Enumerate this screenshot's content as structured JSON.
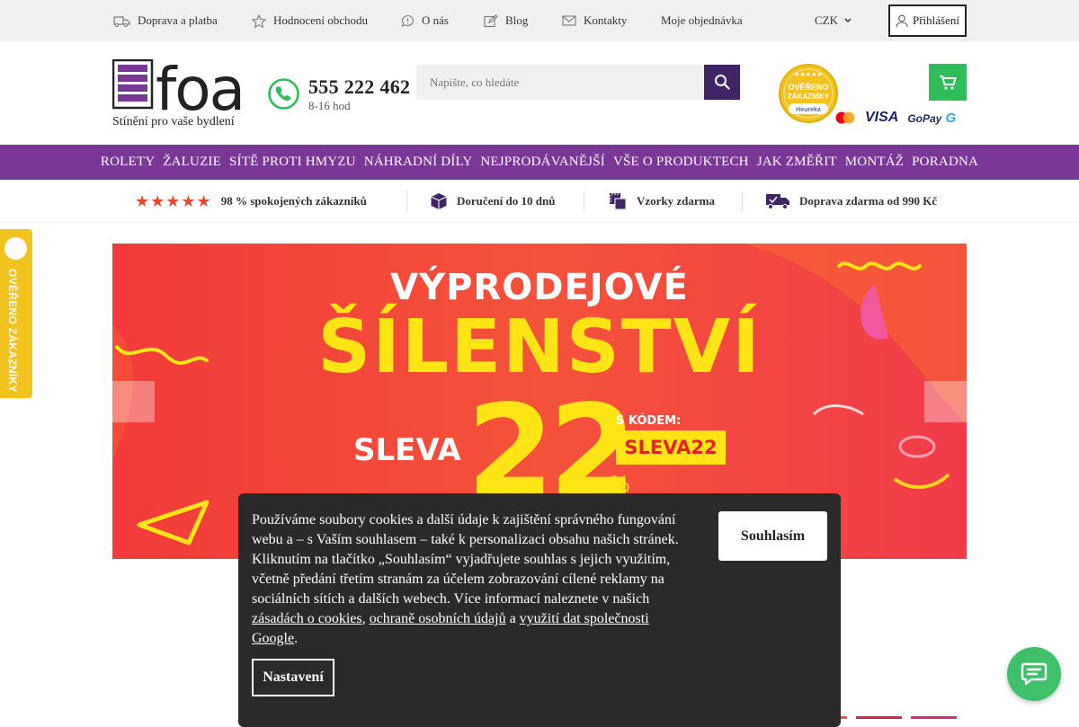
{
  "topbar": {
    "shipping": "Doprava a platba",
    "reviews": "Hodnocení obchodu",
    "about": "O nás",
    "blog": "Blog",
    "contacts": "Kontakty",
    "my_order": "Moje objednávka",
    "currency": "CZK",
    "login": "Přihlášení"
  },
  "header": {
    "logo_text": "foa",
    "tagline": "Stínění pro vaše bydlení",
    "phone": "555 222 462",
    "hours": "8-16 hod",
    "search_placeholder": "Napište, co hledáte",
    "heureka_line1": "OVĚŘENO",
    "heureka_line2": "ZÁKAZNÍKY",
    "heureka_brand": "Heureka",
    "payments": {
      "visa": "VISA",
      "gopay": "GoPay"
    }
  },
  "nav": {
    "items": [
      "ROLETY",
      "ŽALUZIE",
      "SÍTĚ PROTI HMYZU",
      "NÁHRADNÍ DÍLY",
      "NEJPRODÁVANĚJŠÍ",
      "VŠE O PRODUKTECH",
      "JAK ZMĚŘIT",
      "MONTÁŽ",
      "PORADNA"
    ]
  },
  "usp": {
    "stars": "★★★★★",
    "satisfied": "98 % spokojených zákazníků",
    "delivery": "Doručení do 10 dnů",
    "samples": "Vzorky zdarma",
    "free_shipping": "Doprava zdarma od 990 Kč"
  },
  "side_tab": {
    "label": "OVĚŘENO ZÁKAZNÍKY"
  },
  "banner": {
    "line1": "VÝPRODEJOVÉ",
    "line2": "ŠÍLENSTVÍ",
    "sleva": "SLEVA",
    "value": "22",
    "percent": "%",
    "code_label": "S KÓDEM:",
    "code": "SLEVA22"
  },
  "cookie": {
    "text_main": "Používáme soubory cookies a další údaje k zajištění správného fungování webu a – s Vaším souhlasem – také k personalizaci obsahu našich stránek. Kliknutím na tlačítko „Souhlasím“ vyjadřujete souhlas s jejich využitím, včetně předání třetím stranám za účelem zobrazování cílené reklamy na sociálních sítích a dalších webech. Více informací naleznete v našich",
    "link_cookies": "zásadách o cookies",
    "comma": ",",
    "link_privacy": "ochraně osobních údajů",
    "and": "a",
    "link_google": "využití dat společnosti Google",
    "period": ".",
    "accept": "Souhlasím",
    "settings": "Nastavení"
  },
  "colors": {
    "brand_purple": "#7a3896",
    "dark_purple": "#3f2466",
    "cart_green": "#2ebd59",
    "chat_green": "#3fc06a",
    "banner_red": "#f23a3a",
    "banner_yellow": "#ffe516",
    "heureka_yellow": "#f2c21d"
  },
  "icons": [
    "truck-icon",
    "star-icon",
    "comment-icon",
    "edit-icon",
    "mail-icon",
    "user-icon",
    "chevron-down-icon",
    "phone-icon",
    "search-icon",
    "cart-icon",
    "box-icon",
    "samples-icon",
    "delivery-truck-icon",
    "chat-icon",
    "arrow-left-icon",
    "arrow-right-icon"
  ]
}
